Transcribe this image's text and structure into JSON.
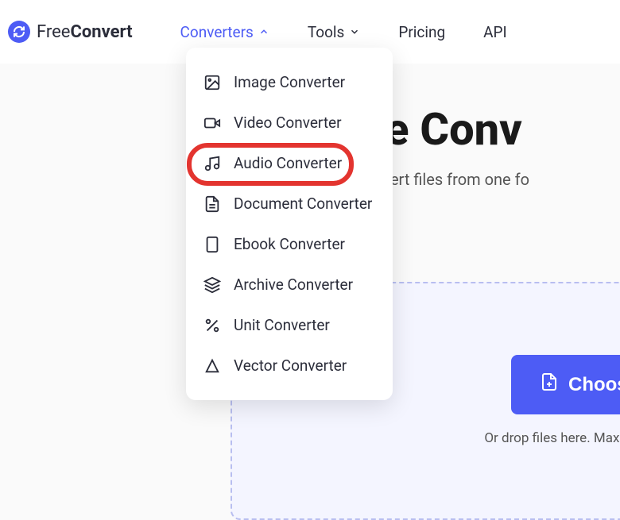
{
  "brand": {
    "free": "Free",
    "convert": "Convert"
  },
  "nav": {
    "converters": "Converters",
    "tools": "Tools",
    "pricing": "Pricing",
    "api": "API"
  },
  "dropdown": {
    "image": "Image Converter",
    "video": "Video Converter",
    "audio": "Audio Converter",
    "document": "Document Converter",
    "ebook": "Ebook Converter",
    "archive": "Archive Converter",
    "unit": "Unit Converter",
    "vector": "Vector Converter"
  },
  "hero": {
    "title": "File Conv",
    "subtitle": "sily convert files from one fo"
  },
  "upload": {
    "button": "Choose File",
    "hint": "Or drop files here. Max file size"
  },
  "colors": {
    "accent": "#4d5cf5",
    "highlight": "#e3342f"
  }
}
